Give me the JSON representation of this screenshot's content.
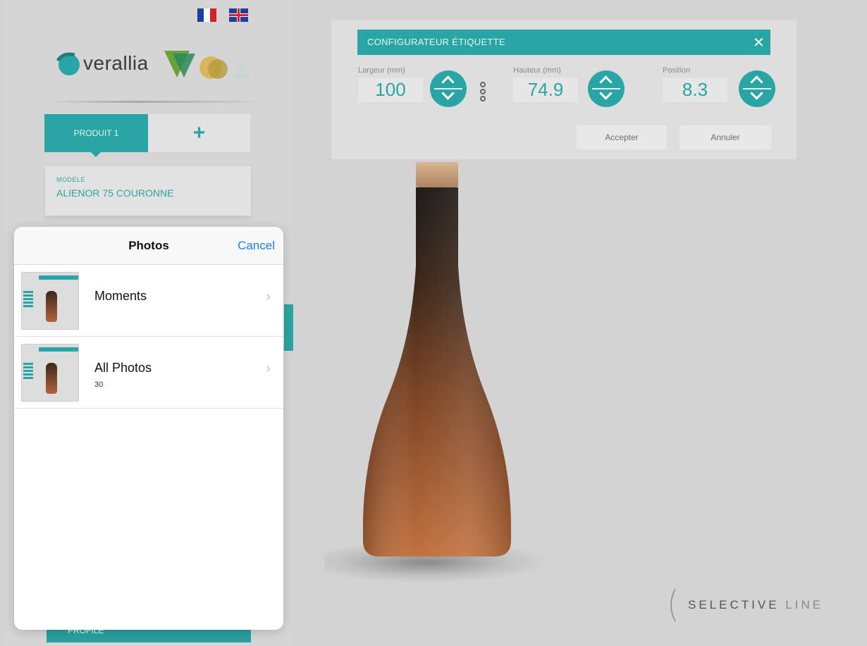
{
  "header": {
    "languages": [
      {
        "code": "fr",
        "icon": "flag-fr-icon"
      },
      {
        "code": "en",
        "icon": "flag-uk-icon"
      }
    ],
    "logo_text": "verallia"
  },
  "tabs": {
    "product_label": "PRODUIT 1",
    "add_label": "+"
  },
  "model": {
    "label": "MODELE",
    "value": "ALIENOR 75 COURONNE"
  },
  "bottom_bar": {
    "label": "PROFILE"
  },
  "photos_popover": {
    "title": "Photos",
    "cancel_label": "Cancel",
    "albums": [
      {
        "name": "Moments",
        "count": ""
      },
      {
        "name": "All Photos",
        "count": "30"
      }
    ]
  },
  "configurator": {
    "title": "CONFIGURATEUR ÉTIQUETTE",
    "close_label": "✕",
    "width_label": "Largeur (mm)",
    "width_value": "100",
    "height_label": "Hauteur (mm)",
    "height_value": "74.9",
    "position_label": "Position",
    "position_value": "8.3",
    "accept_label": "Accepter",
    "cancel_label": "Annuler"
  },
  "brand": {
    "strong": "SELECTIVE",
    "light": "LINE"
  },
  "colors": {
    "accent": "#2aa5a5",
    "ios_blue": "#1a7ef2",
    "background": "#d3d3d3"
  }
}
